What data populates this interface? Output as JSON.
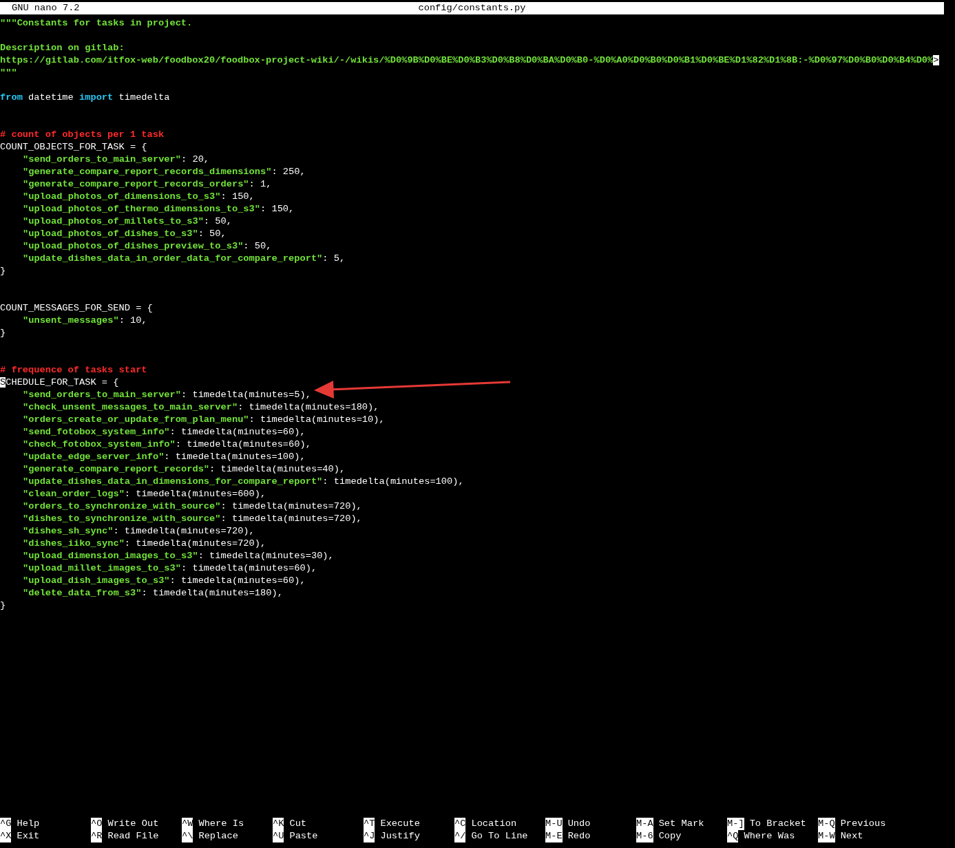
{
  "title_bar": {
    "app": "GNU nano 7.2",
    "filename": "config/constants.py"
  },
  "lines": [
    {
      "kind": "code",
      "indent": false,
      "segments": [
        {
          "kind": "string",
          "text": "\"\"\"Constants for tasks in project."
        }
      ]
    },
    {
      "kind": "blank"
    },
    {
      "kind": "code",
      "indent": false,
      "segments": [
        {
          "kind": "string",
          "text": "Description on gitlab:"
        }
      ]
    },
    {
      "kind": "code",
      "indent": false,
      "segments": [
        {
          "kind": "string",
          "text": "https://gitlab.com/itfox-web/foodbox20/foodbox-project-wiki/-/wikis/%D0%9B%D0%BE%D0%B3%D0%B8%D0%BA%D0%B0-%D0%A0%D0%B0%D0%B1%D0%BE%D1%82%D1%8B:-%D0%97%D0%B0%D0%B4%D0%"
        },
        {
          "kind": "overflow",
          "text": ">"
        }
      ]
    },
    {
      "kind": "code",
      "indent": false,
      "segments": [
        {
          "kind": "string",
          "text": "\"\"\""
        }
      ]
    },
    {
      "kind": "blank"
    },
    {
      "kind": "code",
      "indent": false,
      "segments": [
        {
          "kind": "keyword",
          "text": "from"
        },
        {
          "kind": "plain",
          "text": " datetime "
        },
        {
          "kind": "keyword",
          "text": "import"
        },
        {
          "kind": "plain",
          "text": " timedelta"
        }
      ]
    },
    {
      "kind": "blank"
    },
    {
      "kind": "blank"
    },
    {
      "kind": "code",
      "indent": false,
      "segments": [
        {
          "kind": "comment",
          "text": "# count of objects per 1 task"
        }
      ]
    },
    {
      "kind": "code",
      "indent": false,
      "segments": [
        {
          "kind": "plain",
          "text": "COUNT_OBJECTS_FOR_TASK = {"
        }
      ]
    },
    {
      "kind": "code",
      "indent": true,
      "segments": [
        {
          "kind": "string",
          "text": "\"send_orders_to_main_server\""
        },
        {
          "kind": "plain",
          "text": ": 20,"
        }
      ]
    },
    {
      "kind": "code",
      "indent": true,
      "segments": [
        {
          "kind": "string",
          "text": "\"generate_compare_report_records_dimensions\""
        },
        {
          "kind": "plain",
          "text": ": 250,"
        }
      ]
    },
    {
      "kind": "code",
      "indent": true,
      "segments": [
        {
          "kind": "string",
          "text": "\"generate_compare_report_records_orders\""
        },
        {
          "kind": "plain",
          "text": ": 1,"
        }
      ]
    },
    {
      "kind": "code",
      "indent": true,
      "segments": [
        {
          "kind": "string",
          "text": "\"upload_photos_of_dimensions_to_s3\""
        },
        {
          "kind": "plain",
          "text": ": 150,"
        }
      ]
    },
    {
      "kind": "code",
      "indent": true,
      "segments": [
        {
          "kind": "string",
          "text": "\"upload_photos_of_thermo_dimensions_to_s3\""
        },
        {
          "kind": "plain",
          "text": ": 150,"
        }
      ]
    },
    {
      "kind": "code",
      "indent": true,
      "segments": [
        {
          "kind": "string",
          "text": "\"upload_photos_of_millets_to_s3\""
        },
        {
          "kind": "plain",
          "text": ": 50,"
        }
      ]
    },
    {
      "kind": "code",
      "indent": true,
      "segments": [
        {
          "kind": "string",
          "text": "\"upload_photos_of_dishes_to_s3\""
        },
        {
          "kind": "plain",
          "text": ": 50,"
        }
      ]
    },
    {
      "kind": "code",
      "indent": true,
      "segments": [
        {
          "kind": "string",
          "text": "\"upload_photos_of_dishes_preview_to_s3\""
        },
        {
          "kind": "plain",
          "text": ": 50,"
        }
      ]
    },
    {
      "kind": "code",
      "indent": true,
      "segments": [
        {
          "kind": "string",
          "text": "\"update_dishes_data_in_order_data_for_compare_report\""
        },
        {
          "kind": "plain",
          "text": ": 5,"
        }
      ]
    },
    {
      "kind": "code",
      "indent": false,
      "segments": [
        {
          "kind": "plain",
          "text": "}"
        }
      ]
    },
    {
      "kind": "blank"
    },
    {
      "kind": "blank"
    },
    {
      "kind": "code",
      "indent": false,
      "segments": [
        {
          "kind": "plain",
          "text": "COUNT_MESSAGES_FOR_SEND = {"
        }
      ]
    },
    {
      "kind": "code",
      "indent": true,
      "segments": [
        {
          "kind": "string",
          "text": "\"unsent_messages\""
        },
        {
          "kind": "plain",
          "text": ": 10,"
        }
      ]
    },
    {
      "kind": "code",
      "indent": false,
      "segments": [
        {
          "kind": "plain",
          "text": "}"
        }
      ]
    },
    {
      "kind": "blank"
    },
    {
      "kind": "blank"
    },
    {
      "kind": "code",
      "indent": false,
      "segments": [
        {
          "kind": "comment",
          "text": "# frequence of tasks start"
        }
      ]
    },
    {
      "kind": "code",
      "indent": false,
      "segments": [
        {
          "kind": "cursor",
          "text": "S"
        },
        {
          "kind": "plain",
          "text": "CHEDULE_FOR_TASK = {"
        }
      ]
    },
    {
      "kind": "code",
      "indent": true,
      "segments": [
        {
          "kind": "string",
          "text": "\"send_orders_to_main_server\""
        },
        {
          "kind": "plain",
          "text": ": timedelta(minutes=5),"
        }
      ]
    },
    {
      "kind": "code",
      "indent": true,
      "segments": [
        {
          "kind": "string",
          "text": "\"check_unsent_messages_to_main_server\""
        },
        {
          "kind": "plain",
          "text": ": timedelta(minutes=180),"
        }
      ]
    },
    {
      "kind": "code",
      "indent": true,
      "segments": [
        {
          "kind": "string",
          "text": "\"orders_create_or_update_from_plan_menu\""
        },
        {
          "kind": "plain",
          "text": ": timedelta(minutes=10),"
        }
      ]
    },
    {
      "kind": "code",
      "indent": true,
      "segments": [
        {
          "kind": "string",
          "text": "\"send_fotobox_system_info\""
        },
        {
          "kind": "plain",
          "text": ": timedelta(minutes=60),"
        }
      ]
    },
    {
      "kind": "code",
      "indent": true,
      "segments": [
        {
          "kind": "string",
          "text": "\"check_fotobox_system_info\""
        },
        {
          "kind": "plain",
          "text": ": timedelta(minutes=60),"
        }
      ]
    },
    {
      "kind": "code",
      "indent": true,
      "segments": [
        {
          "kind": "string",
          "text": "\"update_edge_server_info\""
        },
        {
          "kind": "plain",
          "text": ": timedelta(minutes=100),"
        }
      ]
    },
    {
      "kind": "code",
      "indent": true,
      "segments": [
        {
          "kind": "string",
          "text": "\"generate_compare_report_records\""
        },
        {
          "kind": "plain",
          "text": ": timedelta(minutes=40),"
        }
      ]
    },
    {
      "kind": "code",
      "indent": true,
      "segments": [
        {
          "kind": "string",
          "text": "\"update_dishes_data_in_dimensions_for_compare_report\""
        },
        {
          "kind": "plain",
          "text": ": timedelta(minutes=100),"
        }
      ]
    },
    {
      "kind": "code",
      "indent": true,
      "segments": [
        {
          "kind": "string",
          "text": "\"clean_order_logs\""
        },
        {
          "kind": "plain",
          "text": ": timedelta(minutes=600),"
        }
      ]
    },
    {
      "kind": "code",
      "indent": true,
      "segments": [
        {
          "kind": "string",
          "text": "\"orders_to_synchronize_with_source\""
        },
        {
          "kind": "plain",
          "text": ": timedelta(minutes=720),"
        }
      ]
    },
    {
      "kind": "code",
      "indent": true,
      "segments": [
        {
          "kind": "string",
          "text": "\"dishes_to_synchronize_with_source\""
        },
        {
          "kind": "plain",
          "text": ": timedelta(minutes=720),"
        }
      ]
    },
    {
      "kind": "code",
      "indent": true,
      "segments": [
        {
          "kind": "string",
          "text": "\"dishes_sh_sync\""
        },
        {
          "kind": "plain",
          "text": ": timedelta(minutes=720),"
        }
      ]
    },
    {
      "kind": "code",
      "indent": true,
      "segments": [
        {
          "kind": "string",
          "text": "\"dishes_iiko_sync\""
        },
        {
          "kind": "plain",
          "text": ": timedelta(minutes=720),"
        }
      ]
    },
    {
      "kind": "code",
      "indent": true,
      "segments": [
        {
          "kind": "string",
          "text": "\"upload_dimension_images_to_s3\""
        },
        {
          "kind": "plain",
          "text": ": timedelta(minutes=30),"
        }
      ]
    },
    {
      "kind": "code",
      "indent": true,
      "segments": [
        {
          "kind": "string",
          "text": "\"upload_millet_images_to_s3\""
        },
        {
          "kind": "plain",
          "text": ": timedelta(minutes=60),"
        }
      ]
    },
    {
      "kind": "code",
      "indent": true,
      "segments": [
        {
          "kind": "string",
          "text": "\"upload_dish_images_to_s3\""
        },
        {
          "kind": "plain",
          "text": ": timedelta(minutes=60),"
        }
      ]
    },
    {
      "kind": "code",
      "indent": true,
      "segments": [
        {
          "kind": "string",
          "text": "\"delete_data_from_s3\""
        },
        {
          "kind": "plain",
          "text": ": timedelta(minutes=180),"
        }
      ]
    },
    {
      "kind": "code",
      "indent": false,
      "segments": [
        {
          "kind": "plain",
          "text": "}"
        }
      ]
    }
  ],
  "shortcut_rows": [
    [
      {
        "key": "^G",
        "label": "Help"
      },
      {
        "key": "^O",
        "label": "Write Out"
      },
      {
        "key": "^W",
        "label": "Where Is"
      },
      {
        "key": "^K",
        "label": "Cut"
      },
      {
        "key": "^T",
        "label": "Execute"
      },
      {
        "key": "^C",
        "label": "Location"
      },
      {
        "key": "M-U",
        "label": "Undo"
      },
      {
        "key": "M-A",
        "label": "Set Mark"
      },
      {
        "key": "M-]",
        "label": "To Bracket"
      },
      {
        "key": "M-Q",
        "label": "Previous"
      }
    ],
    [
      {
        "key": "^X",
        "label": "Exit"
      },
      {
        "key": "^R",
        "label": "Read File"
      },
      {
        "key": "^\\",
        "label": "Replace"
      },
      {
        "key": "^U",
        "label": "Paste"
      },
      {
        "key": "^J",
        "label": "Justify"
      },
      {
        "key": "^/",
        "label": "Go To Line"
      },
      {
        "key": "M-E",
        "label": "Redo"
      },
      {
        "key": "M-6",
        "label": "Copy"
      },
      {
        "key": "^Q",
        "label": "Where Was"
      },
      {
        "key": "M-W",
        "label": "Next"
      }
    ]
  ]
}
